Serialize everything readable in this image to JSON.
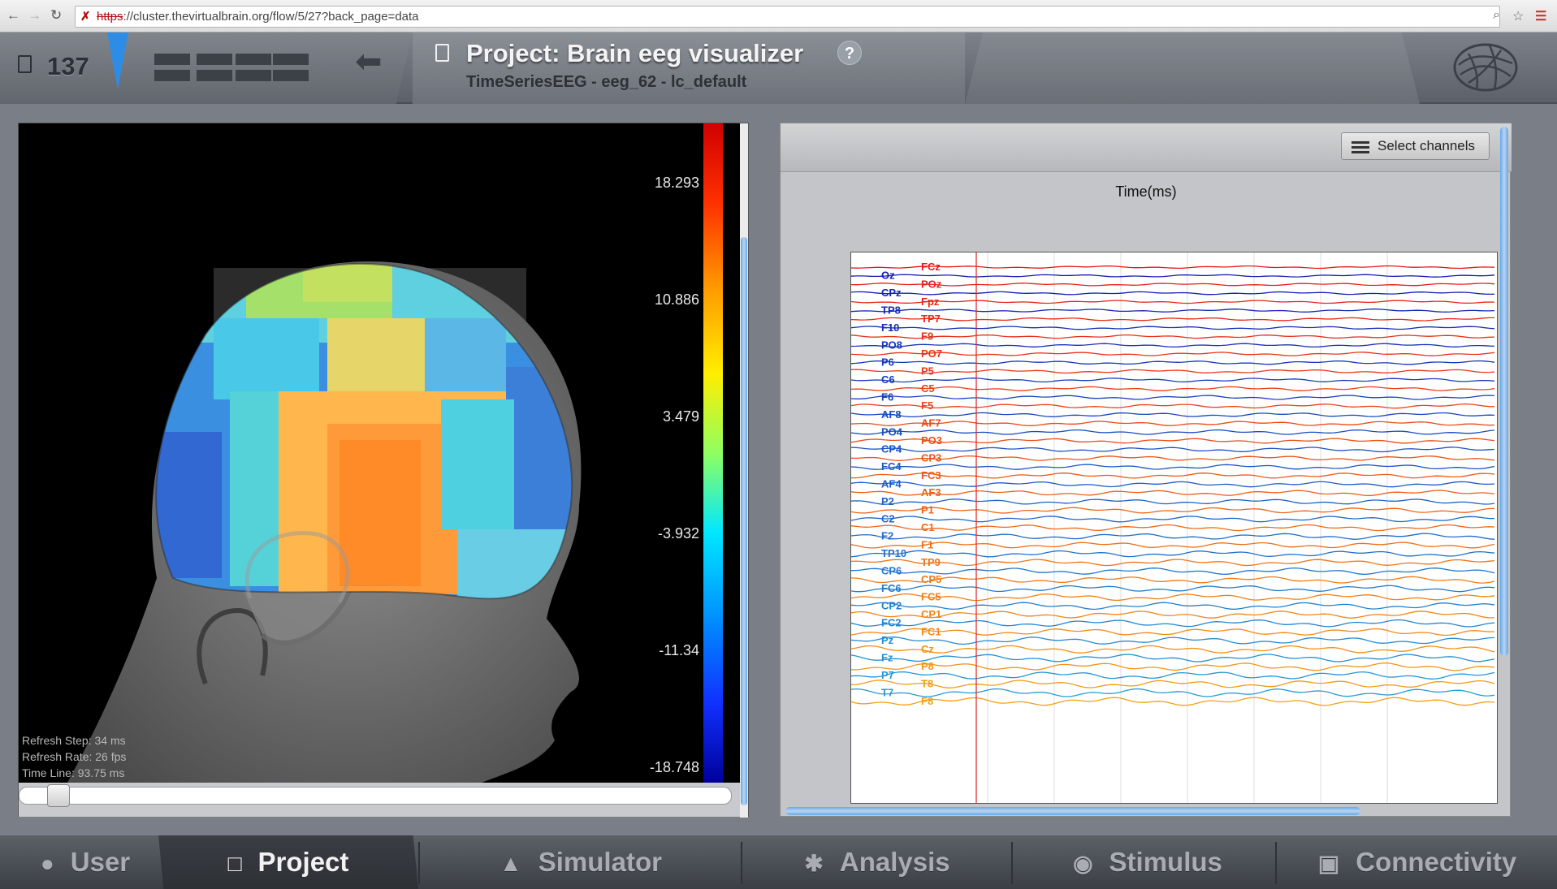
{
  "browser": {
    "url_protocol": "https",
    "url_rest": "://cluster.thevirtualbrain.org/flow/5/27?back_page=data"
  },
  "header": {
    "counter": "137",
    "project_title": "Project: Brain eeg visualizer",
    "subtitle": "TimeSeriesEEG - eeg_62 - lc_default",
    "help_label": "?"
  },
  "brain_view": {
    "colorbar_ticks": [
      "18.293",
      "10.886",
      "3.479",
      "-3.932",
      "-11.34",
      "-18.748"
    ],
    "refresh_step": "Refresh Step: 34 ms",
    "refresh_rate": "Refresh Rate: 26 fps",
    "time_line": "Time Line: 93.75 ms",
    "slider_value": 0.04
  },
  "eeg_view": {
    "select_channels_label": "Select channels",
    "x_axis_label": "Time(ms)",
    "channels_left": [
      "Oz",
      "CPz",
      "TP8",
      "F10",
      "PO8",
      "P6",
      "C6",
      "F6",
      "AF8",
      "PO4",
      "CP4",
      "FC4",
      "AF4",
      "P2",
      "C2",
      "F2",
      "TP10",
      "CP6",
      "FC6",
      "CP2",
      "FC2",
      "Pz",
      "Fz",
      "P7",
      "T7"
    ],
    "channels_right": [
      "FCz",
      "POz",
      "Fpz",
      "TP7",
      "F9",
      "PO7",
      "P5",
      "C5",
      "F5",
      "AF7",
      "PO3",
      "CP3",
      "FC3",
      "AF3",
      "P1",
      "C1",
      "F1",
      "TP9",
      "CP5",
      "FC5",
      "CP1",
      "FC1",
      "Cz",
      "P8",
      "T8",
      "F8"
    ]
  },
  "nav": {
    "tabs": [
      "User",
      "Project",
      "Simulator",
      "Analysis",
      "Stimulus",
      "Connectivity"
    ],
    "active": "Project"
  }
}
